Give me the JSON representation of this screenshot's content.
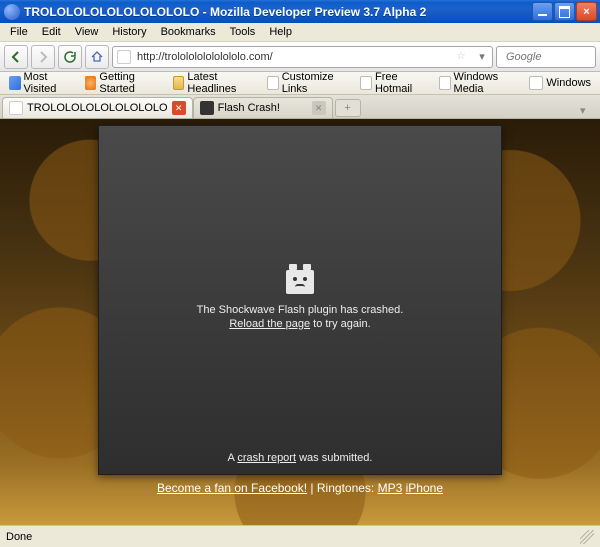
{
  "window": {
    "title": "TROLOLOLOLOLOLOLOLOLO - Mozilla Developer Preview 3.7 Alpha 2"
  },
  "menu": {
    "file": "File",
    "edit": "Edit",
    "view": "View",
    "history": "History",
    "bookmarks": "Bookmarks",
    "tools": "Tools",
    "help": "Help"
  },
  "nav": {
    "url": "http://trololololololololo.com/",
    "search_placeholder": "Google"
  },
  "bookmarks": [
    "Most Visited",
    "Getting Started",
    "Latest Headlines",
    "Customize Links",
    "Free Hotmail",
    "Windows Media",
    "Windows"
  ],
  "tabs": [
    {
      "label": "TROLOLOLOLOLOLOLOLO",
      "active": true
    },
    {
      "label": "Flash Crash!",
      "active": false
    }
  ],
  "newtab": "+",
  "crash": {
    "message": "The Shockwave Flash plugin has crashed.",
    "reload_link": "Reload the page",
    "reload_suffix": " to try again.",
    "report_prefix": "A ",
    "report_link": "crash report",
    "report_suffix": " was submitted."
  },
  "footer": {
    "become_fan": "Become a fan on Facebook!",
    "separator": " | ",
    "ringtones": "Ringtones: ",
    "mp3": "MP3",
    "iphone": "iPhone"
  },
  "status": {
    "text": "Done"
  }
}
